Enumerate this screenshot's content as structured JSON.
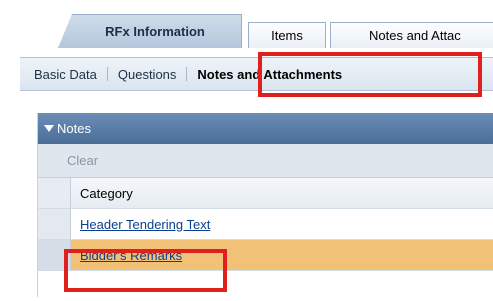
{
  "tabs": {
    "rfx": "RFx Information",
    "items": "Items",
    "notes": "Notes and Attac"
  },
  "subtabs": {
    "basic": "Basic Data",
    "questions": "Questions",
    "notes_attachments": "Notes and Attachments"
  },
  "notes_panel": {
    "title": "Notes",
    "clear_label": "Clear",
    "column_header": "Category",
    "rows": [
      "Header Tendering Text",
      "Bidder's Remarks"
    ]
  },
  "colors": {
    "highlight": "#e0201f",
    "selected_row": "#f1c178",
    "panel_header": "#4a6d98"
  }
}
